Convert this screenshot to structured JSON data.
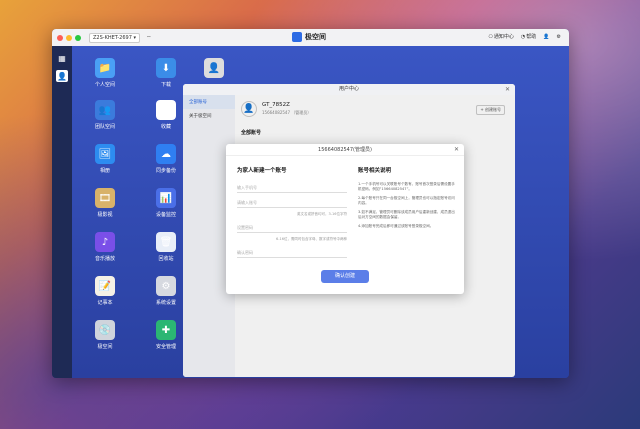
{
  "titlebar": {
    "address": "Z2S-KHET-2697 ▾",
    "brand": "极空间",
    "notify": "通知中心",
    "help": "帮助"
  },
  "desktop": {
    "icons": [
      {
        "label": "个人空间",
        "icon": "folder-icon",
        "color": "#4a9ff5",
        "glyph": "📁"
      },
      {
        "label": "下载",
        "icon": "download-icon",
        "color": "#3b8de8",
        "glyph": "⬇"
      },
      {
        "label": "团队空间",
        "icon": "team-folder-icon",
        "color": "#3b7bdc",
        "glyph": "👥"
      },
      {
        "label": "收藏",
        "icon": "star-icon",
        "color": "#ffffff",
        "glyph": "★"
      },
      {
        "label": "相册",
        "icon": "photo-icon",
        "color": "#2d8cf0",
        "glyph": "🖼"
      },
      {
        "label": "同步备份",
        "icon": "cloud-icon",
        "color": "#2f7ff2",
        "glyph": "☁"
      },
      {
        "label": "极影视",
        "icon": "film-icon",
        "color": "#d8b26a",
        "glyph": "🎞"
      },
      {
        "label": "设备监控",
        "icon": "monitor-icon",
        "color": "#4a6fe8",
        "glyph": "📊"
      },
      {
        "label": "音乐播放",
        "icon": "music-icon",
        "color": "#7a4fe8",
        "glyph": "♪"
      },
      {
        "label": "回收站",
        "icon": "trash-icon",
        "color": "#e8eef8",
        "glyph": "🗑"
      },
      {
        "label": "记事本",
        "icon": "notepad-icon",
        "color": "#f5f1e6",
        "glyph": "📝"
      },
      {
        "label": "系统设置",
        "icon": "gear-icon",
        "color": "#d6d9e0",
        "glyph": "⚙"
      },
      {
        "label": "极空间",
        "icon": "disk-icon",
        "color": "#cfd4dc",
        "glyph": "💿"
      },
      {
        "label": "安全管理",
        "icon": "shield-icon",
        "color": "#2bb673",
        "glyph": "✚"
      }
    ]
  },
  "user_center": {
    "title": "用户中心",
    "nav": [
      "全部账号",
      "关于极空间"
    ],
    "profile": {
      "name": "GT_7852Z",
      "id": "15664082547 （管理员）"
    },
    "add_account": "+ 创建账号",
    "section": "全部账号"
  },
  "dialog": {
    "title": "15664082547(管理员)",
    "left_heading": "为家人新建一个账号",
    "fields": [
      {
        "placeholder": "输入手机号",
        "hint": ""
      },
      {
        "placeholder": "请输入账号",
        "hint": "英文名或拼音均可，3-16位字符"
      },
      {
        "placeholder": "设置密码",
        "hint": "6-16位，需同时包含字母、数字或符号中两种"
      },
      {
        "placeholder": "确认密码",
        "hint": ""
      }
    ],
    "right_heading": "账号相关说明",
    "notes": [
      "1.一个手机号可以关联账号个数有，账号首次登录后需设置手机密码。例如“15664082547”。",
      "2.每个账号只在同一台极空间上，管理员也可以指定账号访问内容。",
      "3.如不满足，管理员可删除该成员用户后重新创建，成员退出后对方空间的数据会保留。",
      "4.添加账号完成后即可通过该账号登录极空间。"
    ],
    "create_button": "确认创建"
  }
}
